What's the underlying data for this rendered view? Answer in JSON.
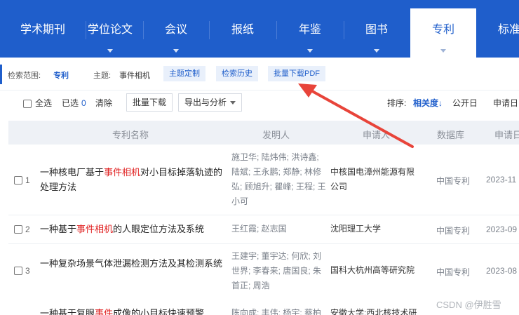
{
  "tabs": [
    {
      "label": "学术期刊",
      "caret": false
    },
    {
      "label": "学位论文",
      "caret": true
    },
    {
      "label": "会议",
      "caret": true
    },
    {
      "label": "报纸",
      "caret": false
    },
    {
      "label": "年鉴",
      "caret": true
    },
    {
      "label": "图书",
      "caret": true
    },
    {
      "label": "专利",
      "caret": true,
      "active": true
    },
    {
      "label": "标准",
      "caret": false
    }
  ],
  "scope": {
    "label": "检索范围:",
    "value": "专利",
    "subject_label": "主题:",
    "subject_value": "事件相机",
    "chips": [
      "主题定制",
      "检索历史",
      "批量下载PDF"
    ]
  },
  "toolbar": {
    "select_all": "全选",
    "selected_label": "已选",
    "selected_count": "0",
    "clear": "清除",
    "batch_download": "批量下载",
    "export_analysis": "导出与分析",
    "sort_label": "排序:",
    "sort_active": "相关度",
    "sort_options": [
      "公开日",
      "申请日"
    ]
  },
  "table": {
    "headers": [
      "专利名称",
      "发明人",
      "申请人",
      "数据库",
      "申请日"
    ],
    "rows": [
      {
        "num": "1",
        "title_before": "一种核电厂基于",
        "title_hl": "事件相机",
        "title_after": "对小目标掉落轨迹的处理方法",
        "inventor": "施卫华; 陆炜伟; 洪诗鑫; 陆斌; 王永鹏; 郑静; 林修弘; 顾旭升; 瞿峰; 王程; 王小可",
        "applicant": "中核国电漳州能源有限公司",
        "db": "中国专利",
        "date": "2023-11"
      },
      {
        "num": "2",
        "title_before": "一种基于",
        "title_hl": "事件相机",
        "title_after": "的人眼定位方法及系统",
        "inventor": "王红霞; 赵志国",
        "applicant": "沈阳理工大学",
        "db": "中国专利",
        "date": "2023-09"
      },
      {
        "num": "3",
        "title_before": "一种复杂场景气体泄漏检测方法及其检测系统",
        "title_hl": "",
        "title_after": "",
        "inventor": "王建宇; 董宇达; 何欣; 刘世界; 李春来; 唐国良; 朱首正; 周浩",
        "applicant": "国科大杭州高等研究院",
        "db": "中国专利",
        "date": "2023-08"
      },
      {
        "num": "4",
        "title_before": "一种基于复眼",
        "title_hl": "事件",
        "title_after": "成像的小目标快速预警",
        "inventor": "陈向成; 丰伟; 杨宇; 蔡柏",
        "applicant": "安徽大学;西北核技术研",
        "db": "",
        "date": ""
      }
    ]
  },
  "watermark": "CSDN @伊胜雪",
  "colors": {
    "primary": "#1f5ecb",
    "highlight": "#e02020",
    "arrow": "#e8443a"
  }
}
